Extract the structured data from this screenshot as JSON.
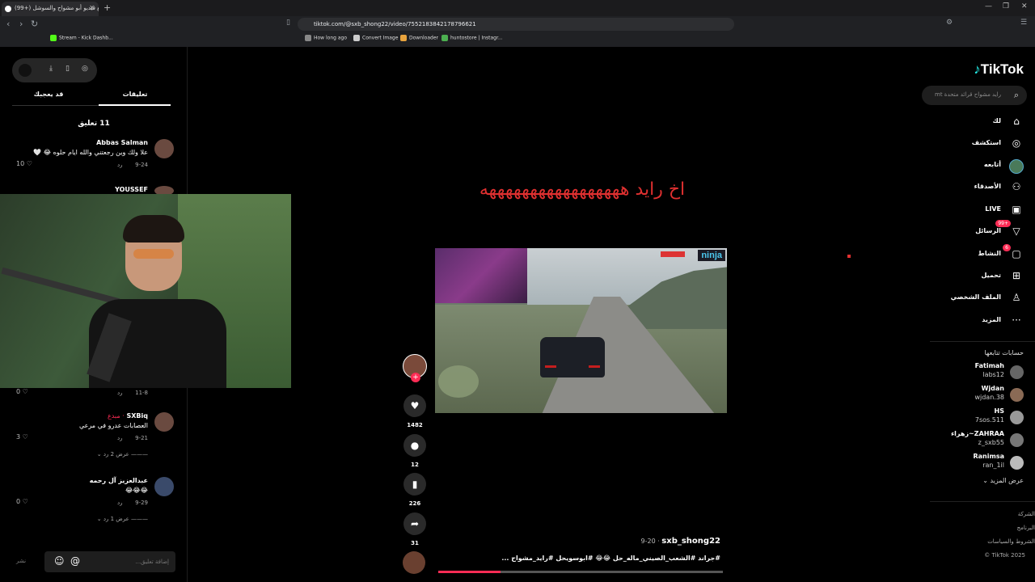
{
  "browser": {
    "tab_title": "(99+) مقاطع فيديو أبو مشواح والسوشل",
    "url": "tiktok.com/@sxb_shong22/video/7552183842178796621",
    "bookmarks": [
      "Stream - Kick Dashb...",
      "How long ago",
      "Convert Image",
      "Downloader",
      "huntostore | Instagr..."
    ]
  },
  "sidebar": {
    "logo": "TikTok",
    "search_placeholder": "رايد مشواح قرائد متحدة mt",
    "nav": [
      {
        "label": "لك",
        "icon": "home-icon"
      },
      {
        "label": "استكشف",
        "icon": "compass-icon"
      },
      {
        "label": "أتابعه",
        "icon": "following-avatar-icon"
      },
      {
        "label": "الأصدقاء",
        "icon": "friends-icon"
      },
      {
        "label": "LIVE",
        "icon": "live-icon"
      },
      {
        "label": "الرسائل",
        "icon": "messages-icon",
        "badge": "+99"
      },
      {
        "label": "النشاط",
        "icon": "activity-icon",
        "badge": "6"
      },
      {
        "label": "تحميل",
        "icon": "upload-icon"
      },
      {
        "label": "الملف الشخصي",
        "icon": "profile-icon"
      },
      {
        "label": "المزيد",
        "icon": "more-icon"
      }
    ],
    "following_title": "حسابات تتابعها",
    "following": [
      {
        "name": "Fatimah",
        "handle": "labs12"
      },
      {
        "name": "Wjdan",
        "handle": "wjdan.38"
      },
      {
        "name": "HS",
        "handle": "7sos.511"
      },
      {
        "name": "ZAHRAA~زهراء",
        "handle": "z_sxb55"
      },
      {
        "name": "Ranimsa",
        "handle": "ran_1il"
      }
    ],
    "see_more": "عرض المزيد",
    "footer": [
      "الشركة",
      "البرنامج",
      "الشروط والسياسات",
      "© TikTok 2025"
    ]
  },
  "video": {
    "overlay_caption": "اخ رايد هههههههههههههههههه",
    "author": "sxb_shong22",
    "date": "9-20",
    "description": "#جراند #الشعب_الصيني_ماله_حل 😂😂 #ابوسويحل #رايد_مشواح ...",
    "likes": "1482",
    "comments": "12",
    "saves": "226",
    "shares": "31",
    "progress": 0.22,
    "watermark": "ninja"
  },
  "comments_panel": {
    "tab_comments": "تعليقات",
    "tab_liked": "قد يعجبك",
    "count_label": "11 تعليق",
    "items": [
      {
        "name": "Abbas Salman",
        "text": "علا ولك وين رجعتني والله ايام حلوه 😂 🤍",
        "date": "9-24",
        "reply": "رد",
        "likes": "10"
      },
      {
        "name": "YOUSSEF",
        "text": "",
        "date": "11-8",
        "reply": "رد",
        "likes": "0"
      },
      {
        "name": "SXBiq",
        "creator": "· مبدع",
        "text": "العصابات عدرو في مرعي",
        "date": "9-21",
        "reply": "رد",
        "likes": "3",
        "replies": "عرض 2 رد"
      },
      {
        "name": "عبدالعزيز آل رحمه",
        "text": "😂😂😂",
        "date": "9-29",
        "reply": "رد",
        "likes": "0",
        "replies": "عرض 1 رد"
      }
    ],
    "input_placeholder": "إضافة تعليق...",
    "post_label": "نشر"
  }
}
